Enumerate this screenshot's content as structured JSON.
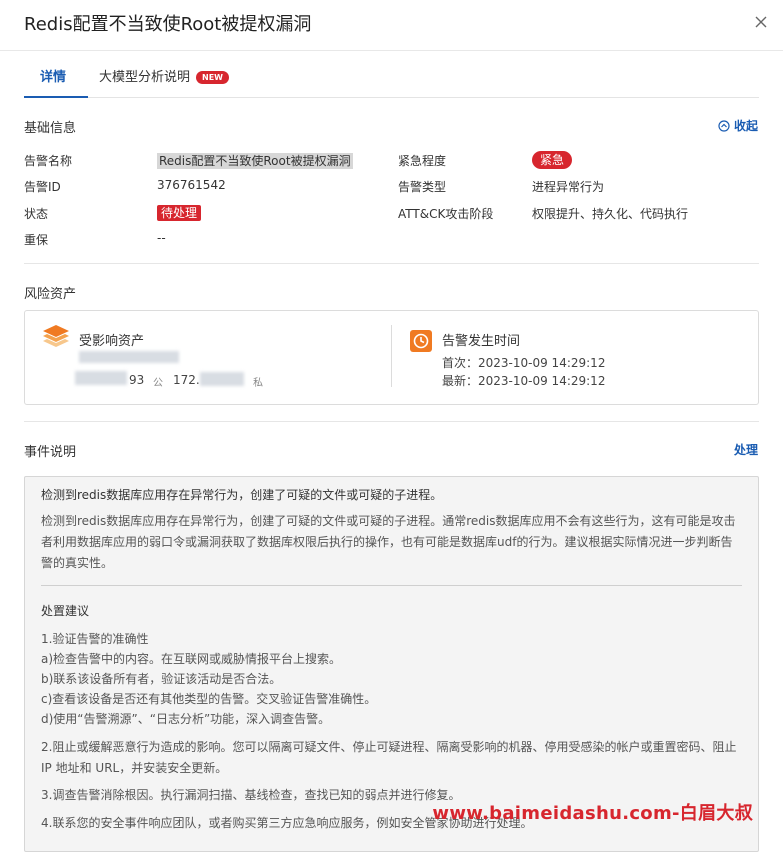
{
  "header": {
    "title": "Redis配置不当致使Root被提权漏洞"
  },
  "tabs": [
    {
      "label": "详情"
    },
    {
      "label": "大模型分析说明",
      "badge": "NEW"
    }
  ],
  "basic": {
    "title": "基础信息",
    "collapse_label": "收起",
    "fields": {
      "alert_name_label": "告警名称",
      "alert_name": "Redis配置不当致使Root被提权漏洞",
      "alert_id_label": "告警ID",
      "alert_id": "376761542",
      "status_label": "状态",
      "status": "待处理",
      "backup_label": "重保",
      "backup": "--",
      "urgency_label": "紧急程度",
      "urgency": "紧急",
      "type_label": "告警类型",
      "type": "进程异常行为",
      "attck_label": "ATT&CK攻击阶段",
      "attck": "权限提升、持久化、代码执行"
    }
  },
  "risk": {
    "title": "风险资产",
    "affected_label": "受影响资产",
    "ip_public_suffix": "93",
    "ip_public_tag": "公",
    "ip_private_prefix": "172.",
    "ip_private_tag": "私",
    "time_label": "告警发生时间",
    "first_time": "首次：2023-10-09 14:29:12",
    "last_time": "最新：2023-10-09 14:29:12"
  },
  "event": {
    "title": "事件说明",
    "action_label": "处理",
    "summary": "检测到redis数据库应用存在异常行为，创建了可疑的文件或可疑的子进程。",
    "detail": "检测到redis数据库应用存在异常行为，创建了可疑的文件或可疑的子进程。通常redis数据库应用不会有这些行为，这有可能是攻击者利用数据库应用的弱口令或漏洞获取了数据库权限后执行的操作，也有可能是数据库udf的行为。建议根据实际情况进一步判断告警的真实性。",
    "advice_title": "处置建议",
    "advice_1_title": "1.验证告警的准确性",
    "advice_1_a": "a)检查告警中的内容。在互联网或威胁情报平台上搜索。",
    "advice_1_b": "b)联系该设备所有者，验证该活动是否合法。",
    "advice_1_c": "c)查看该设备是否还有其他类型的告警。交叉验证告警准确性。",
    "advice_1_d": "d)使用“告警溯源”、“日志分析”功能，深入调查告警。",
    "advice_2": "2.阻止或缓解恶意行为造成的影响。您可以隔离可疑文件、停止可疑进程、隔离受影响的机器、停用受感染的帐户或重置密码、阻止IP 地址和 URL，并安装安全更新。",
    "advice_3": "3.调查告警消除根因。执行漏洞扫描、基线检查，查找已知的弱点并进行修复。",
    "advice_4": "4.联系您的安全事件响应团队，或者购买第三方应急响应服务，例如安全管家协助进行处理。"
  },
  "watermark": "www.baimeidashu.com-白眉大叔",
  "colors": {
    "accent": "#1a5cb2",
    "danger": "#d7262e",
    "orange": "#f07a22"
  }
}
